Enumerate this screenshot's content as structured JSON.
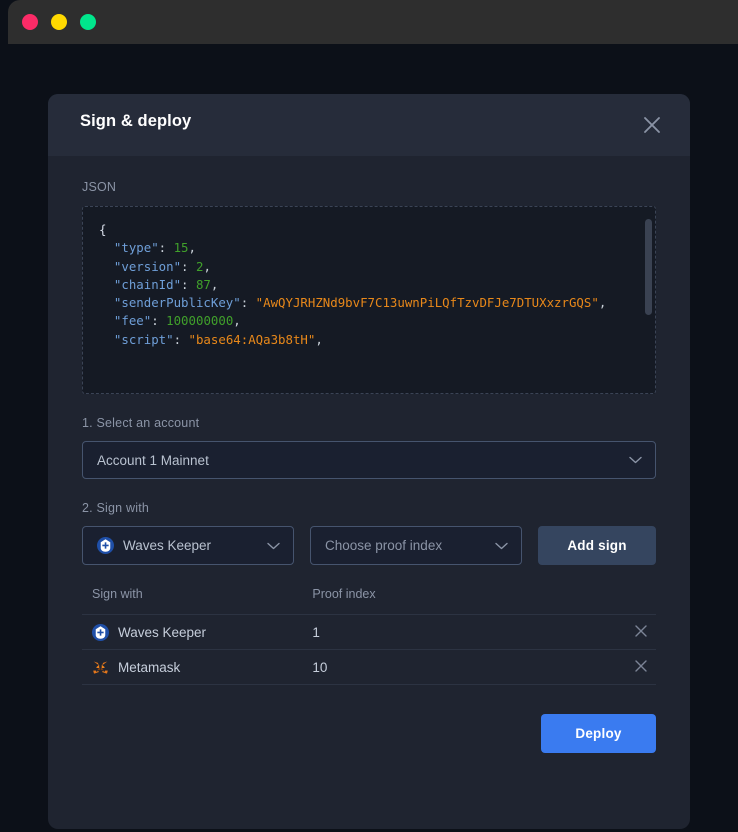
{
  "window": {
    "traffic_lights": [
      {
        "name": "close",
        "color": "#fc2b67"
      },
      {
        "name": "minimize",
        "color": "#ffd900"
      },
      {
        "name": "maximize",
        "color": "#00e68c"
      }
    ]
  },
  "modal": {
    "title": "Sign & deploy",
    "close_label": "×"
  },
  "json_section": {
    "label": "JSON",
    "lines": [
      {
        "indent": 0,
        "tokens": [
          {
            "t": "brace",
            "v": "{"
          }
        ]
      },
      {
        "indent": 1,
        "tokens": [
          {
            "t": "key",
            "v": "\"type\""
          },
          {
            "t": "punct",
            "v": ": "
          },
          {
            "t": "num",
            "v": "15"
          },
          {
            "t": "punct",
            "v": ","
          }
        ]
      },
      {
        "indent": 1,
        "tokens": [
          {
            "t": "key",
            "v": "\"version\""
          },
          {
            "t": "punct",
            "v": ": "
          },
          {
            "t": "num",
            "v": "2"
          },
          {
            "t": "punct",
            "v": ","
          }
        ]
      },
      {
        "indent": 1,
        "tokens": [
          {
            "t": "key",
            "v": "\"chainId\""
          },
          {
            "t": "punct",
            "v": ": "
          },
          {
            "t": "num",
            "v": "87"
          },
          {
            "t": "punct",
            "v": ","
          }
        ]
      },
      {
        "indent": 1,
        "tokens": [
          {
            "t": "key",
            "v": "\"senderPublicKey\""
          },
          {
            "t": "punct",
            "v": ": "
          },
          {
            "t": "str",
            "v": "\"AwQYJRHZNd9bvF7C13uwnPiLQfTzvDFJe7DTUXxzrGQS\""
          },
          {
            "t": "punct",
            "v": ","
          }
        ]
      },
      {
        "indent": 1,
        "tokens": [
          {
            "t": "key",
            "v": "\"fee\""
          },
          {
            "t": "punct",
            "v": ": "
          },
          {
            "t": "num",
            "v": "100000000"
          },
          {
            "t": "punct",
            "v": ","
          }
        ]
      },
      {
        "indent": 1,
        "tokens": [
          {
            "t": "key",
            "v": "\"script\""
          },
          {
            "t": "punct",
            "v": ": "
          },
          {
            "t": "str",
            "v": "\"base64:AQa3b8tH\""
          },
          {
            "t": "punct",
            "v": ","
          }
        ]
      }
    ]
  },
  "step1": {
    "label": "1. Select an account",
    "account_value": "Account 1 Mainnet"
  },
  "step2": {
    "label": "2. Sign with",
    "signer_value": "Waves Keeper",
    "signer_icon": "waves-keeper-icon",
    "proof_placeholder": "Choose proof index",
    "add_sign_label": "Add sign"
  },
  "table": {
    "headers": [
      "Sign with",
      "Proof index"
    ],
    "rows": [
      {
        "wallet": "Waves Keeper",
        "icon": "waves-keeper-icon",
        "proof_index": "1",
        "delete_label": "remove"
      },
      {
        "wallet": "Metamask",
        "icon": "metamask-icon",
        "proof_index": "10",
        "delete_label": "remove"
      }
    ]
  },
  "footer": {
    "deploy_label": "Deploy"
  },
  "colors": {
    "page_bg": "#0c1018",
    "modal_bg": "#1f2430",
    "modal_header_bg": "#262c3a",
    "accent_primary": "#3a7bf0",
    "accent_secondary": "#35455f",
    "border": "#46546e",
    "text_muted": "#8b94a6",
    "json_bg": "#151a24",
    "json_key": "#6f9fd8",
    "json_number": "#40a02b",
    "json_string": "#e8881a"
  }
}
